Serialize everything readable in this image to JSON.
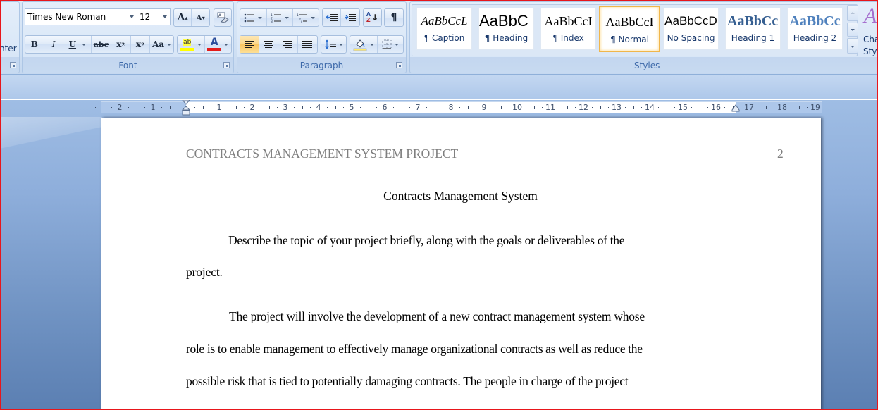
{
  "ribbon": {
    "clipboard": {
      "partial_label": "nter"
    },
    "font": {
      "group_label": "Font",
      "font_name": "Times New Roman",
      "font_size": "12",
      "grow_font_label": "A",
      "shrink_font_label": "A",
      "clear_format_label": "A",
      "bold_label": "B",
      "italic_label": "I",
      "underline_label": "U",
      "strikethrough_label": "abc",
      "subscript_label": "x",
      "superscript_label": "x",
      "change_case_label": "Aa",
      "highlight_label": "ab",
      "font_color_label": "A",
      "highlight_color": "#ffff00",
      "font_color": "#e31b1b"
    },
    "paragraph": {
      "group_label": "Paragraph",
      "sort_label_a": "A",
      "sort_label_z": "Z",
      "show_marks_label": "¶",
      "active_alignment": "align-left"
    },
    "styles": {
      "group_label": "Styles",
      "items": [
        {
          "sample": "AaBbCcL",
          "name": "¶ Caption"
        },
        {
          "sample": "AaBbC",
          "name": "¶ Heading"
        },
        {
          "sample": "AaBbCcI",
          "name": "¶ Index"
        },
        {
          "sample": "AaBbCcI",
          "name": "¶ Normal",
          "selected": true
        },
        {
          "sample": "AaBbCcD",
          "name": "No Spacing"
        },
        {
          "sample": "AaBbCc",
          "name": "Heading 1"
        },
        {
          "sample": "AaBbCc",
          "name": "Heading 2"
        }
      ],
      "change_styles_line1": "Cha",
      "change_styles_line2": "Styl",
      "change_styles_glyph": "A"
    }
  },
  "ruler": {
    "left_numbers": [
      "2",
      "1"
    ],
    "right_numbers": [
      "1",
      "2",
      "3",
      "4",
      "5",
      "6",
      "7",
      "8",
      "9",
      "10",
      "11",
      "12",
      "13",
      "14",
      "15",
      "16",
      "17",
      "18",
      "19"
    ]
  },
  "document": {
    "header": "CONTRACTS MANAGEMENT SYSTEM PROJECT",
    "page_number": "2",
    "title": "Contracts Management System",
    "paragraphs": [
      {
        "lines": [
          "Describe the topic of your project briefly, along with the goals or deliverables of the",
          "project."
        ]
      },
      {
        "lines": [
          "The project will involve the development of a new contract management system whose",
          "role is to enable management to effectively manage organizational contracts as well as reduce the",
          "possible risk that is tied to potentially damaging contracts. The people in charge of the project"
        ]
      }
    ]
  }
}
